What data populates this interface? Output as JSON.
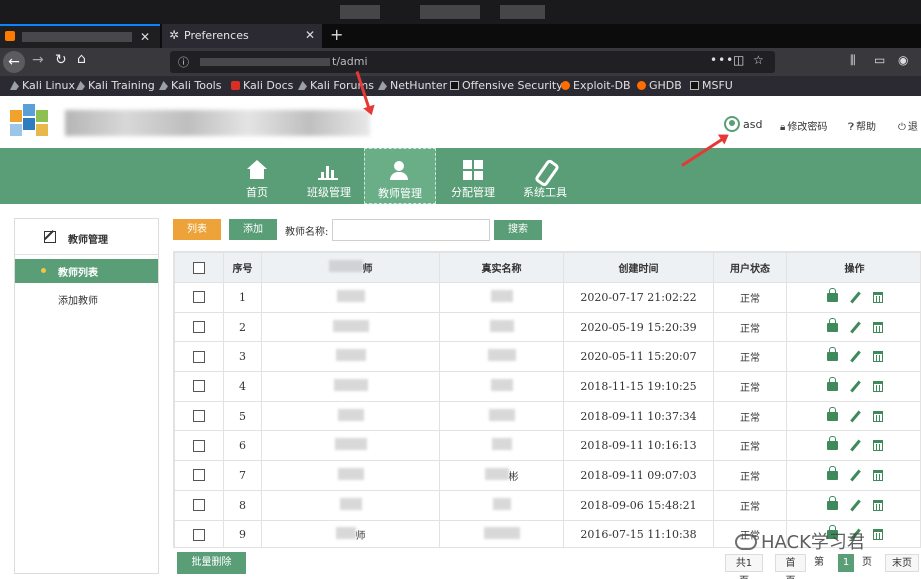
{
  "browser": {
    "tab_active_label": "Preferences",
    "url_fragment": "t/admi",
    "bookmarks": [
      "Kali Linux",
      "Kali Training",
      "Kali Tools",
      "Kali Docs",
      "Kali Forums",
      "NetHunter",
      "Offensive Security",
      "Exploit-DB",
      "GHDB",
      "MSFU"
    ]
  },
  "header": {
    "username": "asd",
    "change_password": "修改密码",
    "help": "帮助",
    "logout": "退"
  },
  "nav": {
    "items": [
      "首页",
      "班级管理",
      "教师管理",
      "分配管理",
      "系统工具"
    ],
    "active_index": 2
  },
  "sidebar": {
    "title": "教师管理",
    "active_item": "教师列表",
    "item": "添加教师"
  },
  "toolbar": {
    "list_label": "列表",
    "add_label": "添加",
    "name_label": "教师名称:",
    "search_value": "",
    "search_label": "搜索"
  },
  "table": {
    "headers": [
      "",
      "序号",
      "师",
      "真实名称",
      "创建时间",
      "用户状态",
      "操作"
    ],
    "rows": [
      {
        "no": "1",
        "created": "2020-07-17 21:02:22",
        "status": "正常",
        "name_tail": "",
        "real_tail": ""
      },
      {
        "no": "2",
        "created": "2020-05-19 15:20:39",
        "status": "正常",
        "name_tail": "",
        "real_tail": ""
      },
      {
        "no": "3",
        "created": "2020-05-11 15:20:07",
        "status": "正常",
        "name_tail": "",
        "real_tail": ""
      },
      {
        "no": "4",
        "created": "2018-11-15 19:10:25",
        "status": "正常",
        "name_tail": "",
        "real_tail": ""
      },
      {
        "no": "5",
        "created": "2018-09-11 10:37:34",
        "status": "正常",
        "name_tail": "",
        "real_tail": ""
      },
      {
        "no": "6",
        "created": "2018-09-11 10:16:13",
        "status": "正常",
        "name_tail": "",
        "real_tail": ""
      },
      {
        "no": "7",
        "created": "2018-09-11 09:07:03",
        "status": "正常",
        "name_tail": "",
        "real_tail": "彬"
      },
      {
        "no": "8",
        "created": "2018-09-06 15:48:21",
        "status": "正常",
        "name_tail": "",
        "real_tail": ""
      },
      {
        "no": "9",
        "created": "2016-07-15 11:10:38",
        "status": "正常",
        "name_tail": "师",
        "real_tail": ""
      }
    ]
  },
  "footer": {
    "batch_delete": "批量删除",
    "total_pages": "共1页",
    "first": "首页",
    "page_prefix": "第",
    "current_page": "1",
    "page_suffix": "页",
    "last": "末页"
  },
  "watermark": "HACK学习君",
  "colors": {
    "primary_green": "#5a9e78",
    "orange": "#eda33a",
    "arrow_red": "#e53935"
  }
}
